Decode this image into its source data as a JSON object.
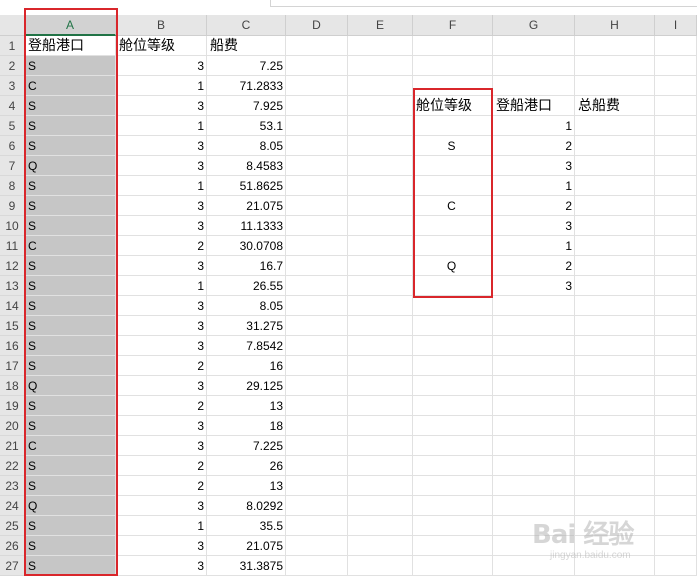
{
  "columns": [
    "A",
    "B",
    "C",
    "D",
    "E",
    "F",
    "G",
    "H",
    "I"
  ],
  "selected_column": "A",
  "rows": [
    [
      "登船港口",
      "舱位等级",
      "船费"
    ],
    [
      "S",
      "3",
      "7.25"
    ],
    [
      "C",
      "1",
      "71.2833"
    ],
    [
      "S",
      "3",
      "7.925"
    ],
    [
      "S",
      "1",
      "53.1"
    ],
    [
      "S",
      "3",
      "8.05"
    ],
    [
      "Q",
      "3",
      "8.4583"
    ],
    [
      "S",
      "1",
      "51.8625"
    ],
    [
      "S",
      "3",
      "21.075"
    ],
    [
      "S",
      "3",
      "11.1333"
    ],
    [
      "C",
      "2",
      "30.0708"
    ],
    [
      "S",
      "3",
      "16.7"
    ],
    [
      "S",
      "1",
      "26.55"
    ],
    [
      "S",
      "3",
      "8.05"
    ],
    [
      "S",
      "3",
      "31.275"
    ],
    [
      "S",
      "3",
      "7.8542"
    ],
    [
      "S",
      "2",
      "16"
    ],
    [
      "Q",
      "3",
      "29.125"
    ],
    [
      "S",
      "2",
      "13"
    ],
    [
      "S",
      "3",
      "18"
    ],
    [
      "C",
      "3",
      "7.225"
    ],
    [
      "S",
      "2",
      "26"
    ],
    [
      "S",
      "2",
      "13"
    ],
    [
      "Q",
      "3",
      "8.0292"
    ],
    [
      "S",
      "1",
      "35.5"
    ],
    [
      "S",
      "3",
      "21.075"
    ],
    [
      "S",
      "3",
      "31.3875"
    ]
  ],
  "row_numbers": [
    "1",
    "2",
    "3",
    "4",
    "5",
    "6",
    "7",
    "8",
    "9",
    "10",
    "11",
    "12",
    "13",
    "14",
    "15",
    "16",
    "17",
    "18",
    "19",
    "20",
    "21",
    "22",
    "23",
    "24",
    "25",
    "26",
    "27"
  ],
  "pivot": {
    "header_f": "舱位等级",
    "header_g": "登船港口",
    "header_h": "总船费",
    "groups": [
      "S",
      "C",
      "Q"
    ],
    "levels": [
      "1",
      "2",
      "3",
      "1",
      "2",
      "3",
      "1",
      "2",
      "3"
    ]
  },
  "watermark": {
    "text": "Bai 经验",
    "sub": "jingyan.baidu.com"
  },
  "colors": {
    "highlight_border": "#d9262b",
    "selected_header": "#217346"
  }
}
